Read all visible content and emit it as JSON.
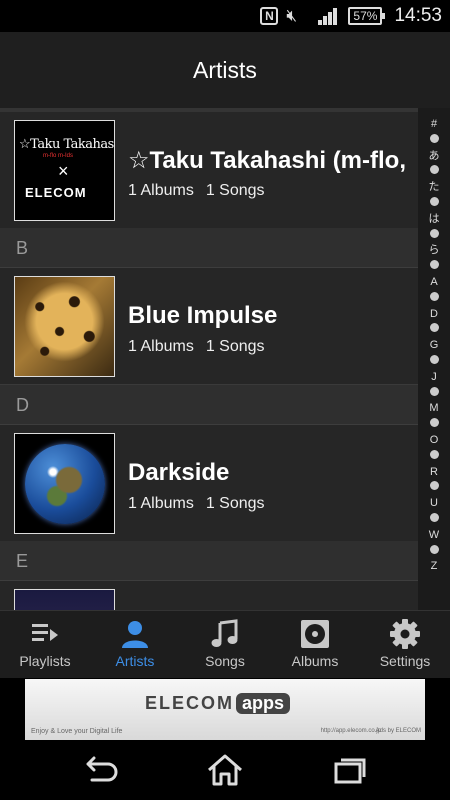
{
  "status_bar": {
    "nfc_icon": "N",
    "battery": "57",
    "time": "14:53"
  },
  "title": "Artists",
  "list": {
    "artists": [
      {
        "name": "☆Taku Takahashi (m-flo,",
        "albums": "1 Albums",
        "songs": "1 Songs",
        "art": {
          "line1": "☆Taku Takahashi",
          "line2": "m-flo m-Ids",
          "line3": "×",
          "line4": "ELECOM"
        }
      },
      {
        "name": "Blue Impulse",
        "albums": "1 Albums",
        "songs": "1 Songs"
      },
      {
        "name": "Darkside",
        "albums": "1 Albums",
        "songs": "1 Songs"
      }
    ],
    "sections": [
      "B",
      "D",
      "E"
    ]
  },
  "index_bar": [
    "#",
    "•",
    "あ",
    "•",
    "た",
    "•",
    "は",
    "•",
    "ら",
    "•",
    "A",
    "•",
    "D",
    "•",
    "G",
    "•",
    "J",
    "•",
    "M",
    "•",
    "O",
    "•",
    "R",
    "•",
    "U",
    "•",
    "W",
    "•",
    "Z"
  ],
  "tabs": [
    {
      "label": "Playlists",
      "icon": "playlist-icon",
      "active": false
    },
    {
      "label": "Artists",
      "icon": "person-icon",
      "active": true
    },
    {
      "label": "Songs",
      "icon": "music-note-icon",
      "active": false
    },
    {
      "label": "Albums",
      "icon": "album-icon",
      "active": false
    },
    {
      "label": "Settings",
      "icon": "gear-icon",
      "active": false
    }
  ],
  "ad": {
    "logo": "ELECOM",
    "logo_apps": "apps",
    "tagline": "Enjoy & Love your Digital Life",
    "url": "http://app.elecom.co.jp",
    "made_by": "Ads by ELECOM"
  },
  "colors": {
    "accent": "#3d8ee6",
    "list_bg": "#262626",
    "header_bg": "#1f1f1f"
  }
}
